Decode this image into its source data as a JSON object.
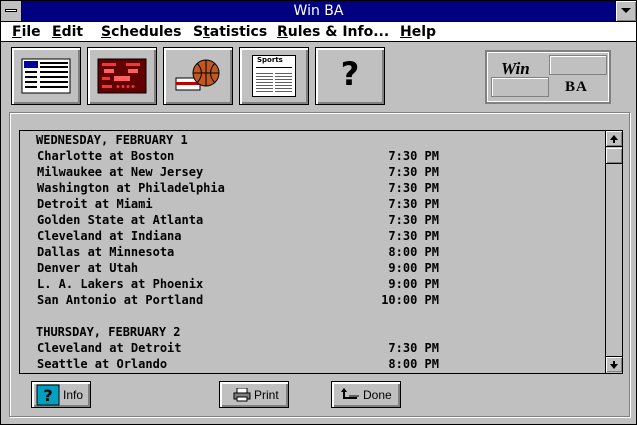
{
  "window": {
    "title": "Win  BA"
  },
  "menu": [
    {
      "label": "File",
      "accel": "F",
      "rest": "ile"
    },
    {
      "label": "Edit",
      "accel": "E",
      "rest": "dit"
    },
    {
      "label": "Schedules",
      "accel": "S",
      "rest": "chedules"
    },
    {
      "label": "Statistics",
      "accel": "t",
      "pre": "S",
      "rest": "atistics"
    },
    {
      "label": "Rules & Info...",
      "accel": "R",
      "rest": "ules & Info..."
    },
    {
      "label": "Help",
      "accel": "H",
      "rest": "elp"
    }
  ],
  "toolbar": {
    "standings_icon": "nba-standings-icon",
    "scoreboard_icon": "scoreboard-icon",
    "basketball_icon": "basketball-hoop-icon",
    "sports_icon": "sports-newspaper-icon",
    "sports_text": "Sports",
    "help_icon": "question-mark-icon",
    "help_text": "?"
  },
  "logo": {
    "win": "Win",
    "ba": "BA"
  },
  "schedule": {
    "days": [
      {
        "header": "WEDNESDAY, FEBRUARY 1",
        "games": [
          {
            "matchup": "Charlotte at Boston",
            "time": "7:30 PM"
          },
          {
            "matchup": "Milwaukee at New Jersey",
            "time": "7:30 PM"
          },
          {
            "matchup": "Washington at Philadelphia",
            "time": "7:30 PM"
          },
          {
            "matchup": "Detroit at Miami",
            "time": "7:30 PM"
          },
          {
            "matchup": "Golden State at Atlanta",
            "time": "7:30 PM"
          },
          {
            "matchup": "Cleveland at Indiana",
            "time": "7:30 PM"
          },
          {
            "matchup": "Dallas at Minnesota",
            "time": "8:00 PM"
          },
          {
            "matchup": "Denver at Utah",
            "time": "9:00 PM"
          },
          {
            "matchup": "L. A. Lakers at Phoenix",
            "time": "9:00 PM"
          },
          {
            "matchup": "San Antonio at Portland",
            "time": "10:00 PM"
          }
        ]
      },
      {
        "header": "THURSDAY, FEBRUARY 2",
        "games": [
          {
            "matchup": "Cleveland at Detroit",
            "time": "7:30 PM"
          },
          {
            "matchup": "Seattle at Orlando",
            "time": "8:00 PM"
          }
        ]
      }
    ]
  },
  "buttons": {
    "info": "Info",
    "print": "Print",
    "done": "Done"
  },
  "colors": {
    "titlebar": "#000080",
    "face": "#c0c0c0",
    "scoreboard_bg": "#600000",
    "scoreboard_text": "#ff3030",
    "ball": "#c05820"
  }
}
